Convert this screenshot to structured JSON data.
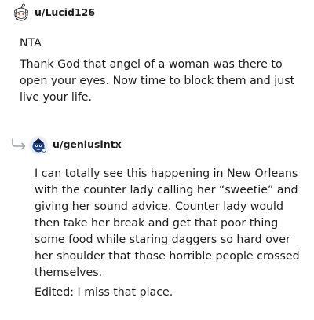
{
  "comments": [
    {
      "username": "u/Lucid126",
      "paragraphs": [
        "NTA",
        "Thank God that angel of a woman was there to open your eyes. Now time to block them and just live your life."
      ],
      "avatar_icon": "snoo-avatar-icon"
    },
    {
      "username": "u/geniusintx",
      "paragraphs": [
        "I can totally see this happening in New Orleans with the counter lady calling her “sweetie” and giving her sound advice. Counter lady would then take her break and get that poor thing some food while staring daggers so hard over her shoulder that those horrible people crossed themselves.",
        "Edited: I miss that place."
      ],
      "avatar_icon": "custom-avatar-icon",
      "reply_icon": "reply-arrow-icon"
    }
  ],
  "colors": {
    "text": "#1c1c1c",
    "meta": "#7c7c7c",
    "reply_arrow": "#a0a4aa"
  }
}
